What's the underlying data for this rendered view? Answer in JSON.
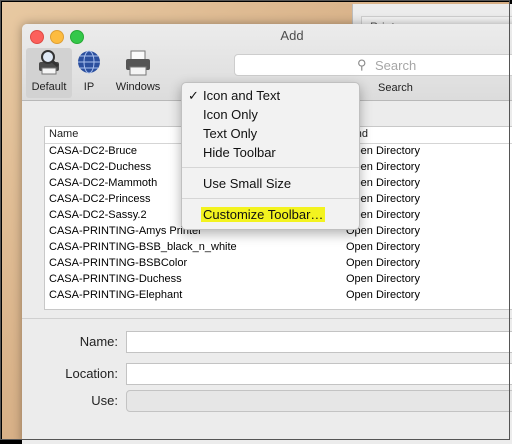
{
  "window": {
    "title": "Add"
  },
  "bg_window": {
    "title": "Printers"
  },
  "toolbar": {
    "items": [
      {
        "label": "Default",
        "icon": "magnifier-printer-icon"
      },
      {
        "label": "IP",
        "icon": "globe-icon"
      },
      {
        "label": "Windows",
        "icon": "printer-icon"
      }
    ],
    "search": {
      "placeholder": "Search",
      "label": "Search"
    }
  },
  "list": {
    "columns": [
      "Name",
      "Kind"
    ],
    "rows": [
      {
        "name": "CASA-DC2-Bruce",
        "kind": "Open Directory"
      },
      {
        "name": "CASA-DC2-Duchess",
        "kind": "Open Directory"
      },
      {
        "name": "CASA-DC2-Mammoth",
        "kind": "Open Directory"
      },
      {
        "name": "CASA-DC2-Princess",
        "kind": "Open Directory"
      },
      {
        "name": "CASA-DC2-Sassy.2",
        "kind": "Open Directory"
      },
      {
        "name": "CASA-PRINTING-Amys Printer",
        "kind": "Open Directory"
      },
      {
        "name": "CASA-PRINTING-BSB_black_n_white",
        "kind": "Open Directory"
      },
      {
        "name": "CASA-PRINTING-BSBColor",
        "kind": "Open Directory"
      },
      {
        "name": "CASA-PRINTING-Duchess",
        "kind": "Open Directory"
      },
      {
        "name": "CASA-PRINTING-Elephant",
        "kind": "Open Directory"
      }
    ]
  },
  "form": {
    "name_label": "Name:",
    "location_label": "Location:",
    "use_label": "Use:"
  },
  "menu": {
    "checkmark": "✓",
    "items": [
      "Icon and Text",
      "Icon Only",
      "Text Only",
      "Hide Toolbar",
      "Use Small Size",
      "Customize Toolbar…"
    ],
    "checked_item": "Icon and Text",
    "highlight_color": "#f3f31f"
  }
}
